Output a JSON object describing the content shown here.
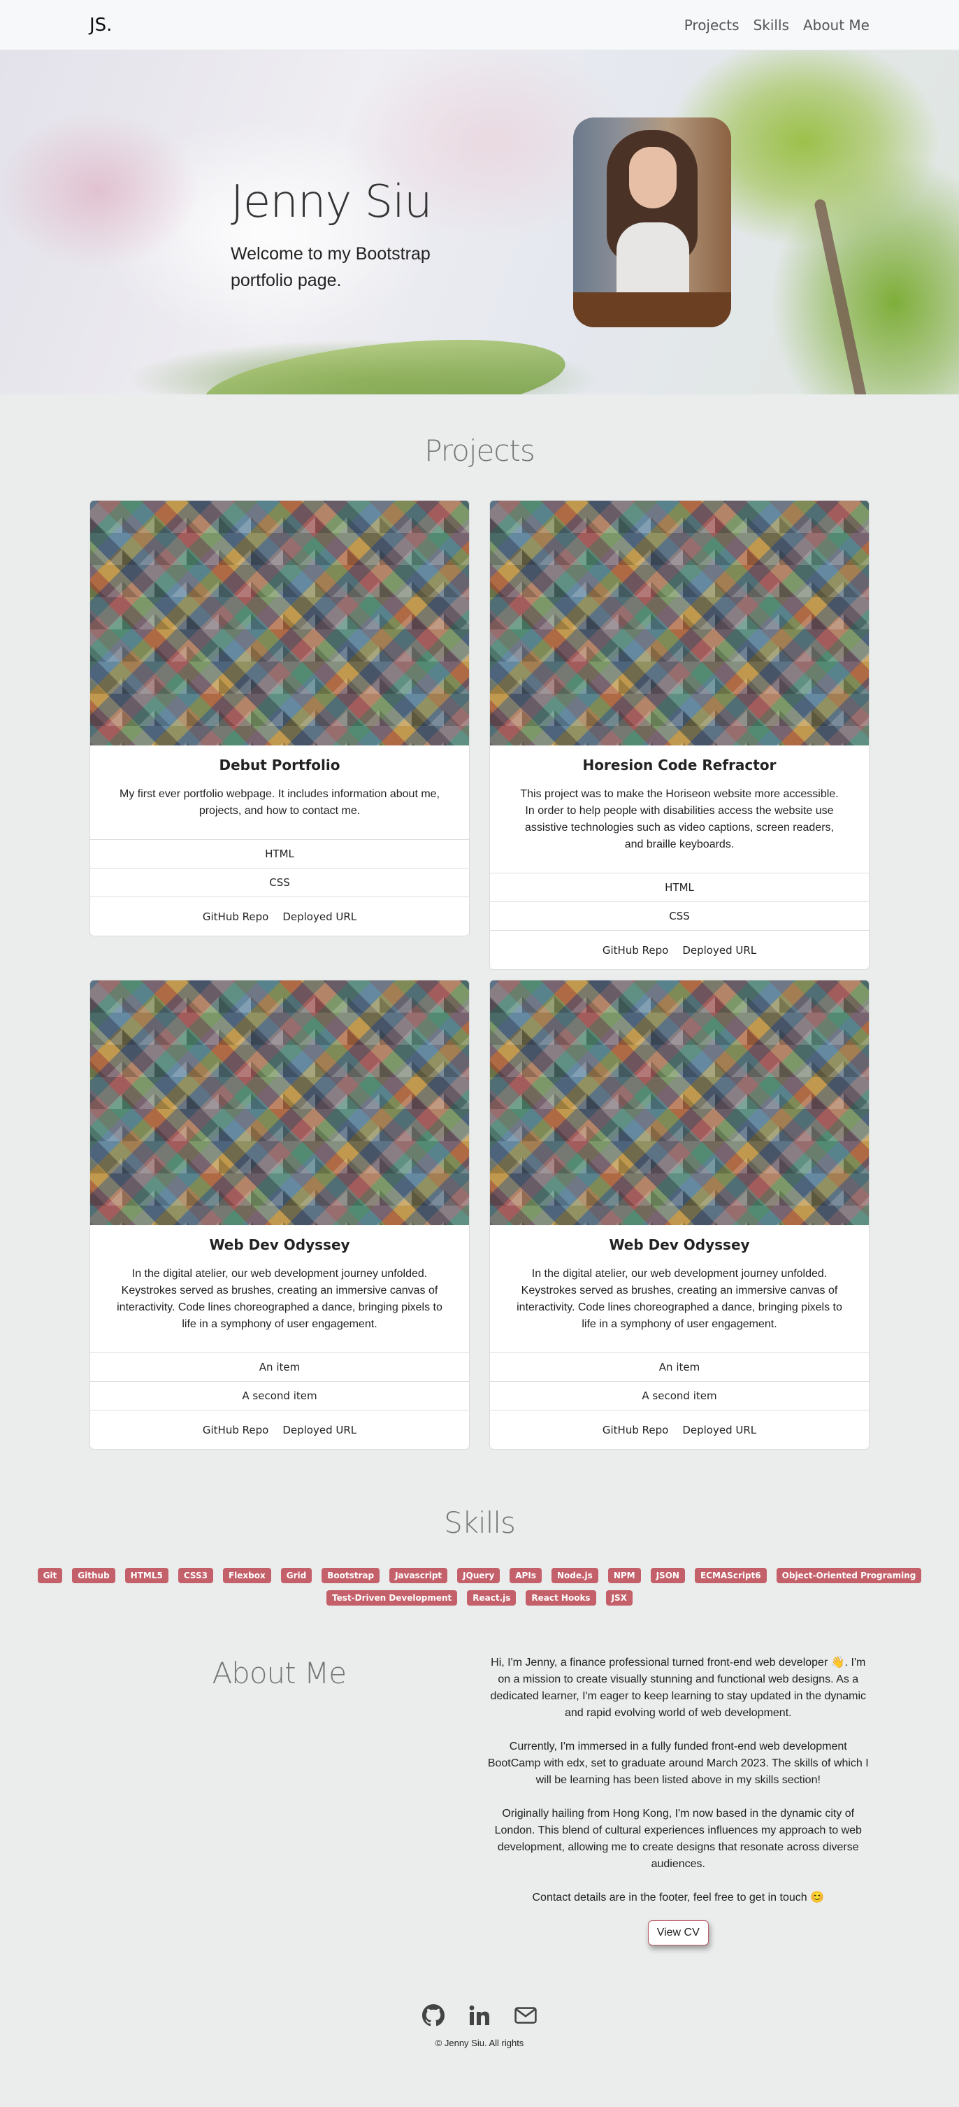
{
  "nav": {
    "brand": "JS.",
    "links": [
      "Projects",
      "Skills",
      "About Me"
    ]
  },
  "hero": {
    "name": "Jenny Siu",
    "welcome": "Welcome to my Bootstrap portfolio page."
  },
  "projects": {
    "title": "Projects",
    "cards": [
      {
        "title": "Debut Portfolio",
        "text": "My first ever portfolio webpage. It includes information about me, projects, and how to contact me.",
        "items": [
          "HTML",
          "CSS"
        ],
        "links": [
          "GitHub Repo",
          "Deployed URL"
        ]
      },
      {
        "title": "Horesion Code Refractor",
        "text": "This project was to make the Horiseon website more accessible. In order to help people with disabilities access the website use assistive technologies such as video captions, screen readers, and braille keyboards.",
        "items": [
          "HTML",
          "CSS"
        ],
        "links": [
          "GitHub Repo",
          "Deployed URL"
        ]
      },
      {
        "title": "Web Dev Odyssey",
        "text": "In the digital atelier, our web development journey unfolded. Keystrokes served as brushes, creating an immersive canvas of interactivity. Code lines choreographed a dance, bringing pixels to life in a symphony of user engagement.",
        "items": [
          "An item",
          "A second item"
        ],
        "links": [
          "GitHub Repo",
          "Deployed URL"
        ]
      },
      {
        "title": "Web Dev Odyssey",
        "text": "In the digital atelier, our web development journey unfolded. Keystrokes served as brushes, creating an immersive canvas of interactivity. Code lines choreographed a dance, bringing pixels to life in a symphony of user engagement.",
        "items": [
          "An item",
          "A second item"
        ],
        "links": [
          "GitHub Repo",
          "Deployed URL"
        ]
      }
    ]
  },
  "skills": {
    "title": "Skills",
    "badges": [
      "Git",
      "Github",
      "HTML5",
      "CSS3",
      "Flexbox",
      "Grid",
      "Bootstrap",
      "Javascript",
      "JQuery",
      "APIs",
      "Node.js",
      "NPM",
      "JSON",
      "ECMAScript6",
      "Object-Oriented Programing",
      "Test-Driven Development",
      "React.js",
      "React Hooks",
      "JSX"
    ]
  },
  "about": {
    "title": "About Me",
    "paragraphs": [
      "Hi, I'm Jenny, a finance professional turned front-end web developer 👋. I'm on a mission to create visually stunning and functional web designs. As a dedicated learner, I'm eager to keep learning to stay updated in the dynamic and rapid evolving world of web development.",
      "Currently, I'm immersed in a fully funded front-end web development BootCamp with edx, set to graduate around March 2023. The skills of which I will be learning has been listed above in my skills section!",
      "Originally hailing from Hong Kong, I'm now based in the dynamic city of London. This blend of cultural experiences influences my approach to web development, allowing me to create designs that resonate across diverse audiences.",
      "Contact details are in the footer, feel free to get in touch 😊"
    ],
    "cv_button": "View CV"
  },
  "footer": {
    "icons": [
      "github-icon",
      "linkedin-icon",
      "envelope-icon"
    ],
    "copyright": "© Jenny Siu. All rights"
  },
  "colors": {
    "badge": "#c4606a",
    "background": "#ebeded",
    "navbar": "#f7f8f9"
  }
}
